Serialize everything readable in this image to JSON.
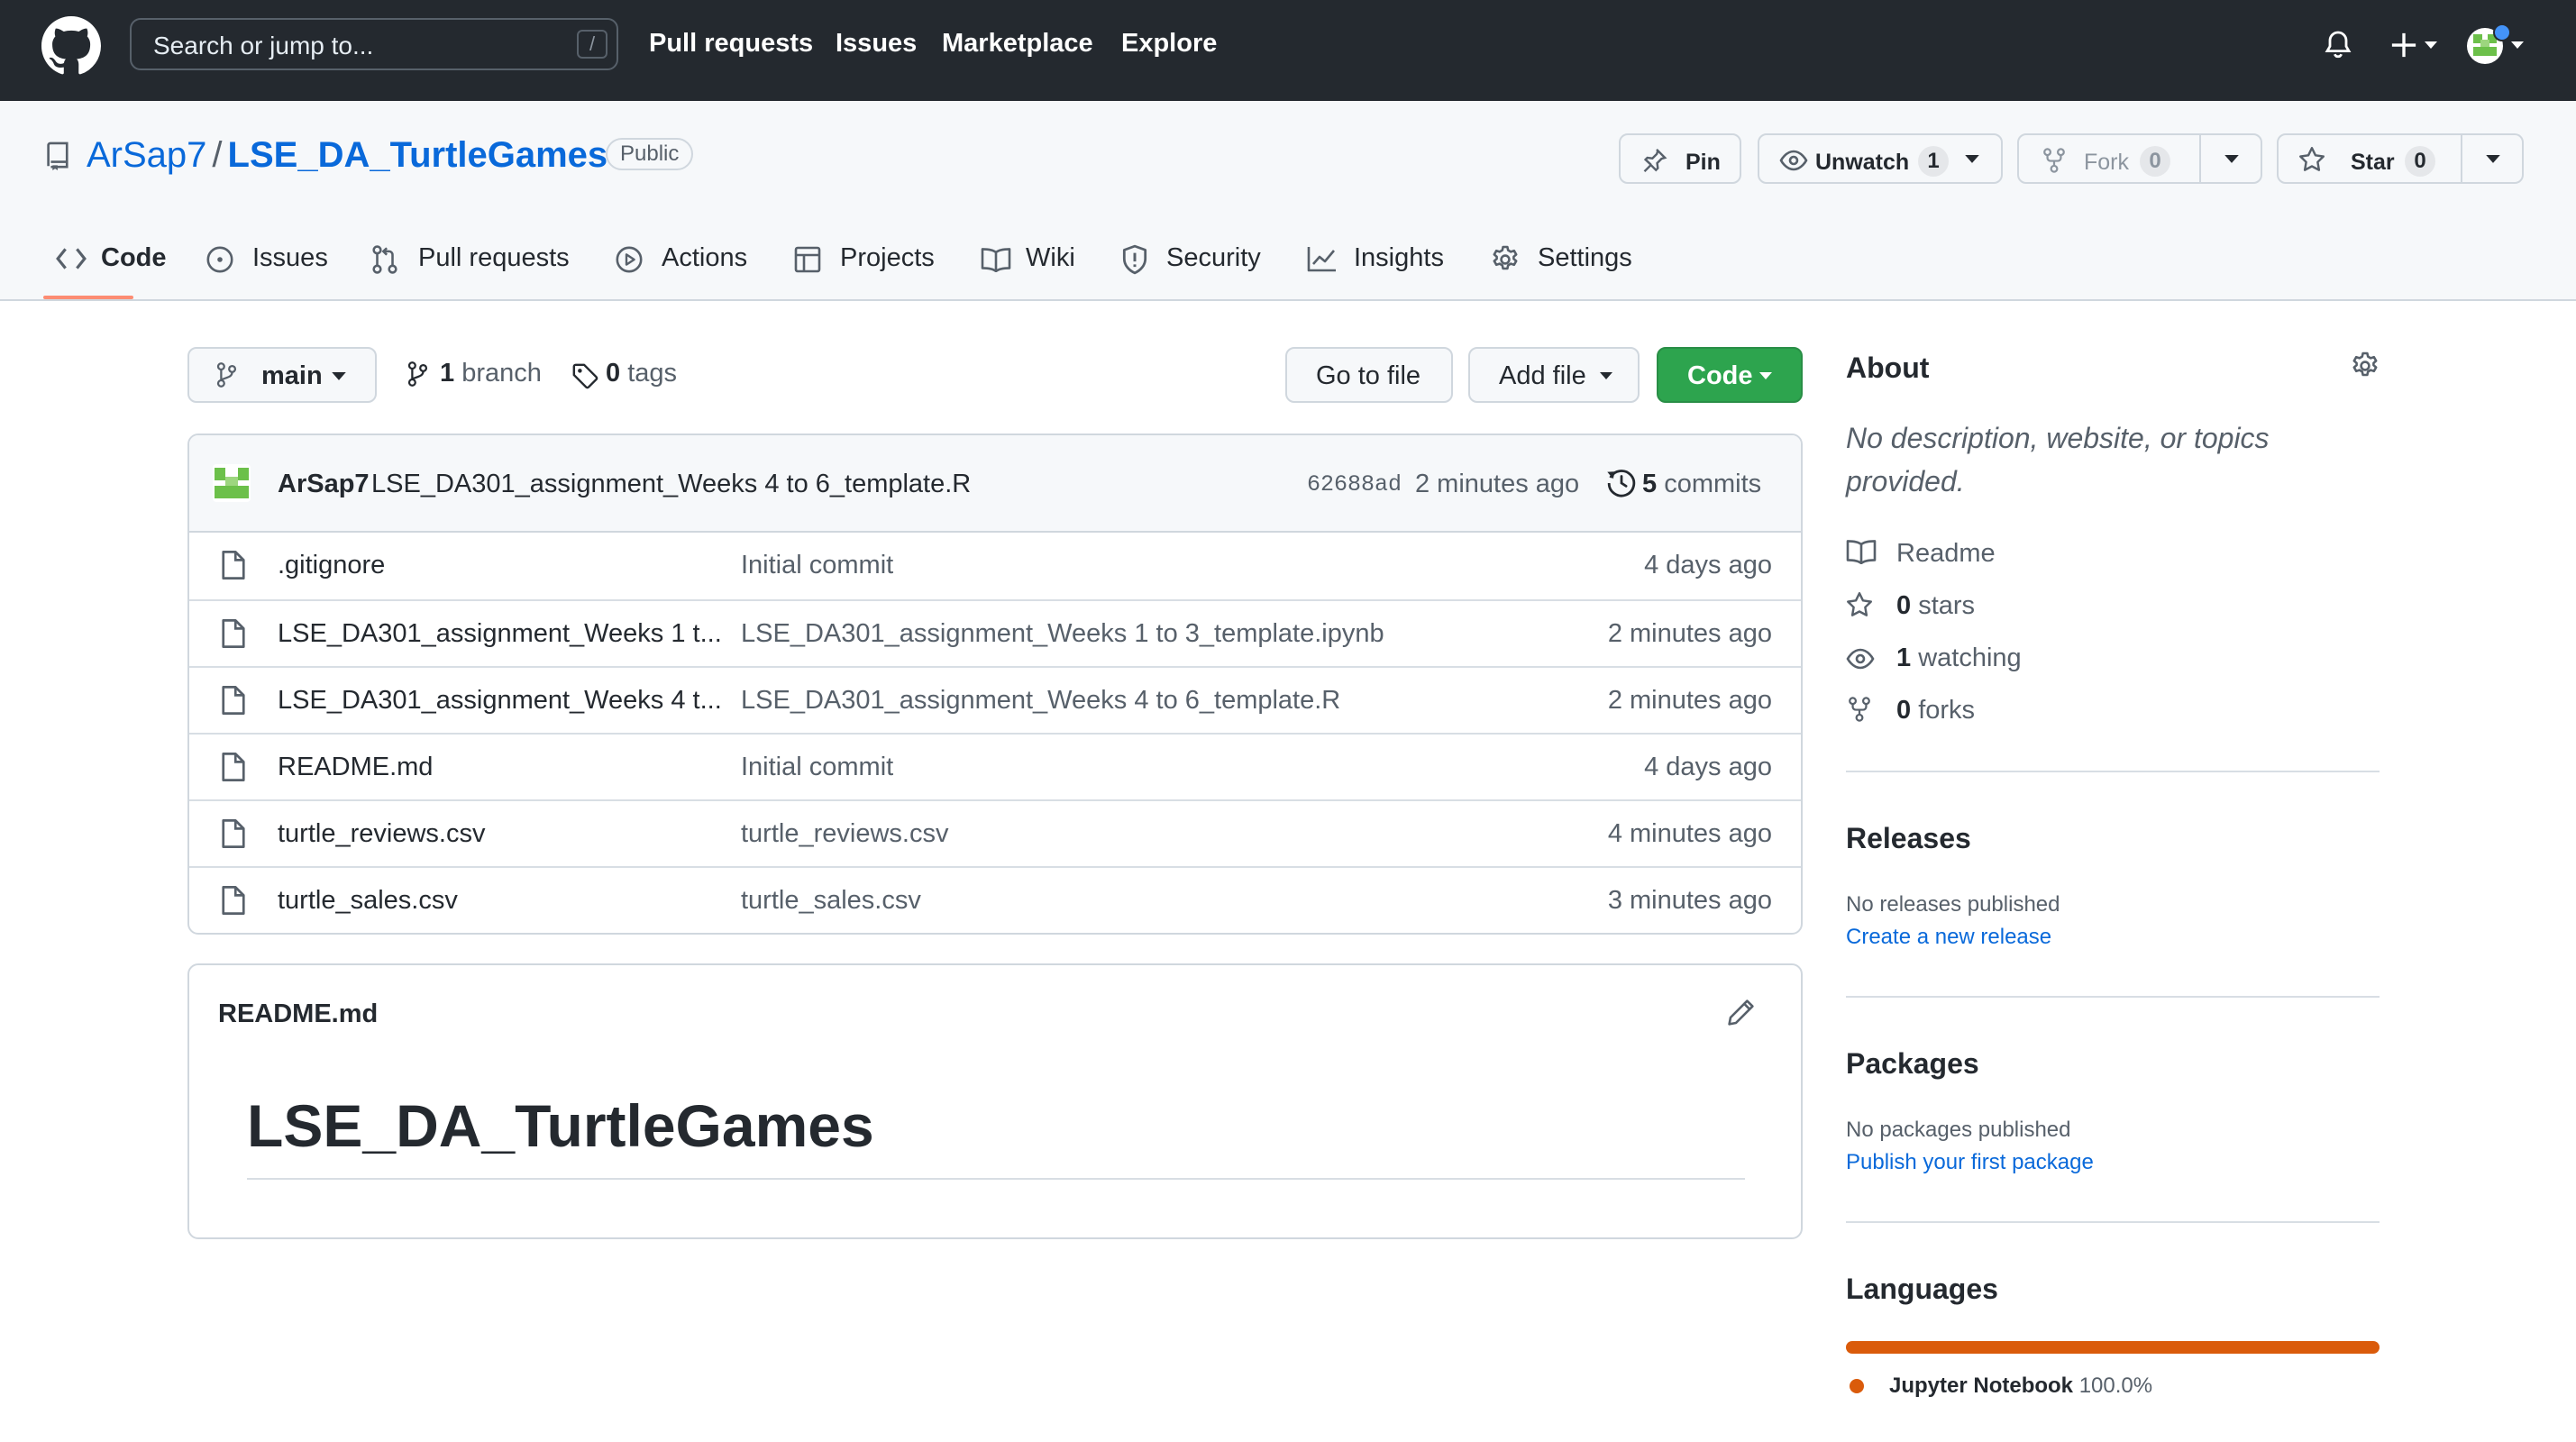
{
  "topbar": {
    "search_placeholder": "Search or jump to...",
    "search_shortcut": "/",
    "nav": [
      "Pull requests",
      "Issues",
      "Marketplace",
      "Explore"
    ]
  },
  "repo": {
    "owner": "ArSap7",
    "separator": "/",
    "name": "LSE_DA_TurtleGames",
    "visibility": "Public",
    "pin_label": "Pin",
    "watch_label": "Unwatch",
    "watch_count": "1",
    "fork_label": "Fork",
    "fork_count": "0",
    "star_label": "Star",
    "star_count": "0"
  },
  "tabs": [
    "Code",
    "Issues",
    "Pull requests",
    "Actions",
    "Projects",
    "Wiki",
    "Security",
    "Insights",
    "Settings"
  ],
  "toolbar": {
    "branch": "main",
    "branch_count": "1",
    "branch_label": "branch",
    "tag_count": "0",
    "tag_label": "tags",
    "go_to_file": "Go to file",
    "add_file": "Add file",
    "code": "Code"
  },
  "latest_commit": {
    "author": "ArSap7",
    "message": "LSE_DA301_assignment_Weeks 4 to 6_template.R",
    "sha": "62688ad",
    "age": "2 minutes ago",
    "commit_count": "5",
    "commit_label": "commits"
  },
  "files": [
    {
      "name": ".gitignore",
      "message": "Initial commit",
      "age": "4 days ago"
    },
    {
      "name": "LSE_DA301_assignment_Weeks 1 t...",
      "message": "LSE_DA301_assignment_Weeks 1 to 3_template.ipynb",
      "age": "2 minutes ago"
    },
    {
      "name": "LSE_DA301_assignment_Weeks 4 t...",
      "message": "LSE_DA301_assignment_Weeks 4 to 6_template.R",
      "age": "2 minutes ago"
    },
    {
      "name": "README.md",
      "message": "Initial commit",
      "age": "4 days ago"
    },
    {
      "name": "turtle_reviews.csv",
      "message": "turtle_reviews.csv",
      "age": "4 minutes ago"
    },
    {
      "name": "turtle_sales.csv",
      "message": "turtle_sales.csv",
      "age": "3 minutes ago"
    }
  ],
  "readme": {
    "filename": "README.md",
    "heading": "LSE_DA_TurtleGames"
  },
  "about": {
    "title": "About",
    "description": "No description, website, or topics provided.",
    "readme": "Readme",
    "stars_count": "0",
    "stars_label": "stars",
    "watching_count": "1",
    "watching_label": "watching",
    "forks_count": "0",
    "forks_label": "forks"
  },
  "releases": {
    "title": "Releases",
    "empty": "No releases published",
    "link": "Create a new release"
  },
  "packages": {
    "title": "Packages",
    "empty": "No packages published",
    "link": "Publish your first package"
  },
  "languages": {
    "title": "Languages",
    "items": [
      {
        "name": "Jupyter Notebook",
        "percent": "100.0%",
        "share": 1.0,
        "color": "#DA5B0B"
      }
    ]
  },
  "colors": {
    "header_bg": "#24292f",
    "link": "#0969da",
    "primary_button": "#2da44e",
    "tab_underline": "#fd8c73"
  }
}
